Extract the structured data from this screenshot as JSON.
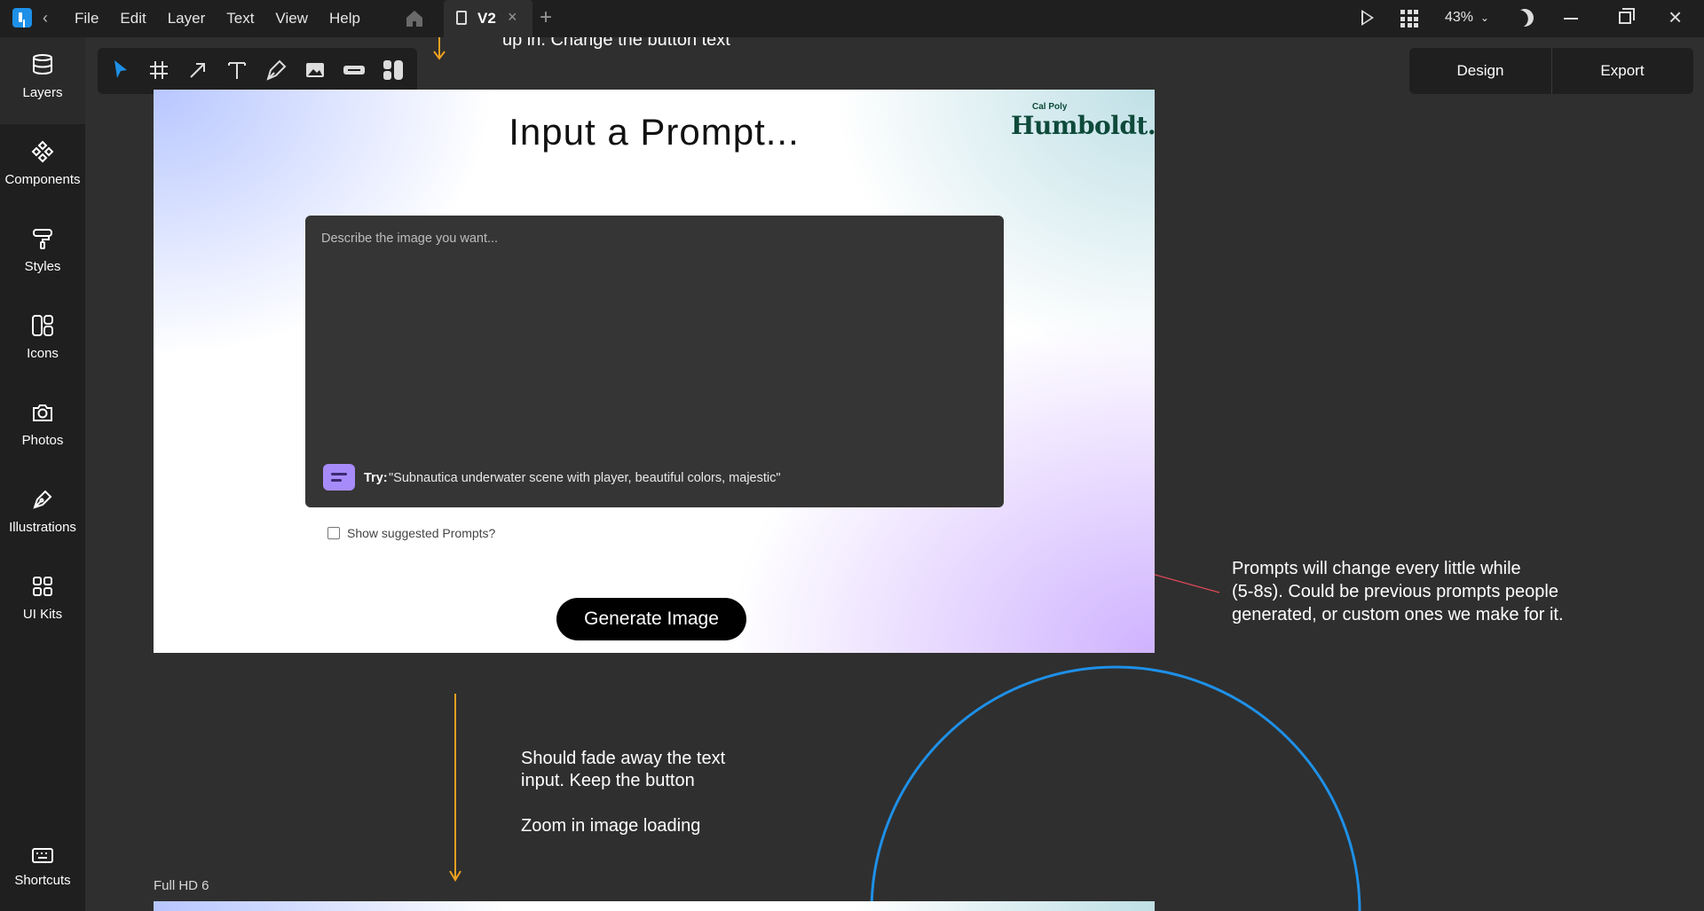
{
  "menu": [
    "File",
    "Edit",
    "Layer",
    "Text",
    "View",
    "Help"
  ],
  "tab": {
    "label": "V2",
    "close": "×",
    "add": "+"
  },
  "zoom": "43%",
  "sidebar": {
    "items": [
      {
        "label": "Layers",
        "icon": "layers-icon"
      },
      {
        "label": "Components",
        "icon": "components-icon"
      },
      {
        "label": "Styles",
        "icon": "styles-icon"
      },
      {
        "label": "Icons",
        "icon": "icons-icon"
      },
      {
        "label": "Photos",
        "icon": "camera-icon"
      },
      {
        "label": "Illustrations",
        "icon": "pen-icon"
      },
      {
        "label": "UI Kits",
        "icon": "grid-icon"
      }
    ],
    "shortcuts": "Shortcuts"
  },
  "panel": {
    "design": "Design",
    "export": "Export"
  },
  "top_note": "up in. Change the button text",
  "frame": {
    "title": "Input a Prompt...",
    "logo_small": "Cal Poly",
    "logo_big": "Humboldt.",
    "prompt_placeholder": "Describe the image you want...",
    "try_label": "Try:",
    "try_text": "\"Subnautica underwater scene with player, beautiful colors, majestic\"",
    "suggest_label": "Show suggested Prompts?",
    "generate": "Generate Image"
  },
  "notes": {
    "prompts_1": "Prompts will change every little while",
    "prompts_2": "(5-8s). Could be previous prompts people",
    "prompts_3": "generated, or custom ones we make for it.",
    "fade_1": "Should fade away the text",
    "fade_2": "input. Keep the button",
    "fade_3": "Zoom in image loading"
  },
  "frame2_label": "Full HD 6",
  "colors": {
    "accent": "#1e90e8",
    "arrow": "#f0a020",
    "connector": "#e0485a",
    "circle": "#1e90e8",
    "try_icon": "#a78bfa"
  }
}
